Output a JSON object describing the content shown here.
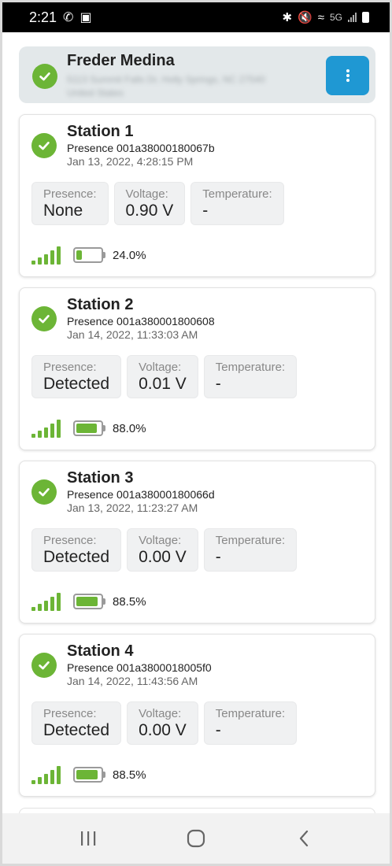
{
  "status_bar": {
    "time": "2:21",
    "network_label": "5G"
  },
  "user": {
    "name": "Freder Medina",
    "address_line1": "5113 Summit Falls Dr, Holly Springs, NC 27540",
    "address_line2": "United States"
  },
  "stations": [
    {
      "title": "Station 1",
      "sensor": "Presence  001a38000180067b",
      "date": "Jan 13, 2022, 4:28:15 PM",
      "readings": [
        {
          "label": "Presence:",
          "value": "None"
        },
        {
          "label": "Voltage:",
          "value": "0.90 V"
        },
        {
          "label": "Temperature:",
          "value": "-"
        }
      ],
      "battery_percent": 24.0,
      "battery_text": "24.0%"
    },
    {
      "title": "Station 2",
      "sensor": "Presence  001a380001800608",
      "date": "Jan 14, 2022, 11:33:03 AM",
      "readings": [
        {
          "label": "Presence:",
          "value": "Detected"
        },
        {
          "label": "Voltage:",
          "value": "0.01 V"
        },
        {
          "label": "Temperature:",
          "value": "-"
        }
      ],
      "battery_percent": 88.0,
      "battery_text": "88.0%"
    },
    {
      "title": "Station 3",
      "sensor": "Presence  001a38000180066d",
      "date": "Jan 13, 2022, 11:23:27 AM",
      "readings": [
        {
          "label": "Presence:",
          "value": "Detected"
        },
        {
          "label": "Voltage:",
          "value": "0.00 V"
        },
        {
          "label": "Temperature:",
          "value": "-"
        }
      ],
      "battery_percent": 88.5,
      "battery_text": "88.5%"
    },
    {
      "title": "Station 4",
      "sensor": "Presence  001a3800018005f0",
      "date": "Jan 14, 2022, 11:43:56 AM",
      "readings": [
        {
          "label": "Presence:",
          "value": "Detected"
        },
        {
          "label": "Voltage:",
          "value": "0.00 V"
        },
        {
          "label": "Temperature:",
          "value": "-"
        }
      ],
      "battery_percent": 88.5,
      "battery_text": "88.5%"
    }
  ],
  "icons": {
    "status_check": "check-circle-icon",
    "menu": "more-vertical-icon",
    "signal": "signal-strength-icon",
    "battery": "battery-icon",
    "nav_recents": "recents-icon",
    "nav_home": "home-icon",
    "nav_back": "back-icon"
  },
  "colors": {
    "accent_green": "#6cb536",
    "menu_blue": "#1f98d3",
    "header_card_bg": "#e3e8ea"
  }
}
